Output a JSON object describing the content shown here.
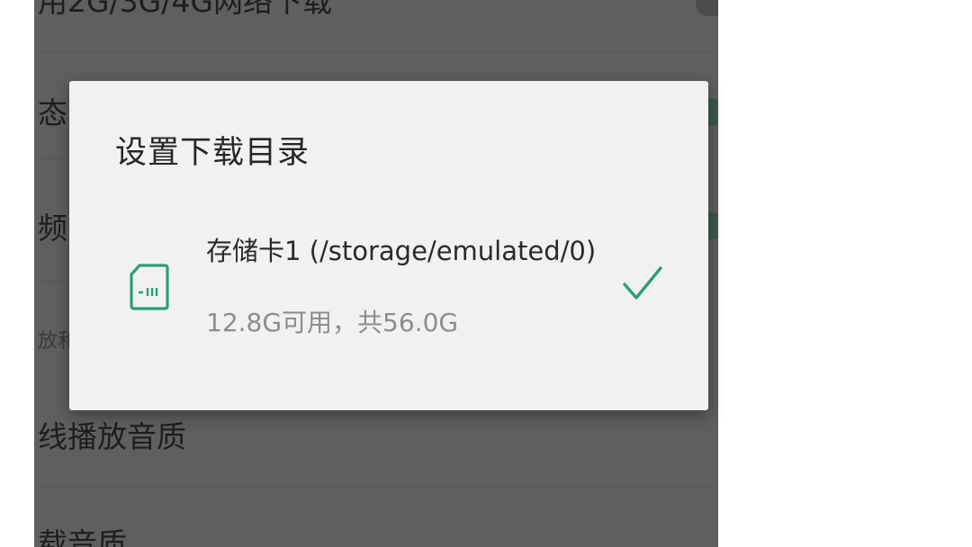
{
  "background": {
    "rows": [
      "用2G/3G/4G网络下载",
      "态",
      "频",
      "放和",
      "线播放音质",
      "载音质"
    ]
  },
  "dialog": {
    "title": "设置下载目录",
    "options": [
      {
        "name": "存储卡1 (/storage/emulated/0)",
        "space": "12.8G可用，共56.0G",
        "icon": "sd-card-icon",
        "selected": true,
        "selected_icon": "checkmark-icon"
      }
    ]
  },
  "colors": {
    "accent": "#2f9e79",
    "dialog_bg": "#f1f1f1",
    "scrim": "#5f5f5f"
  }
}
